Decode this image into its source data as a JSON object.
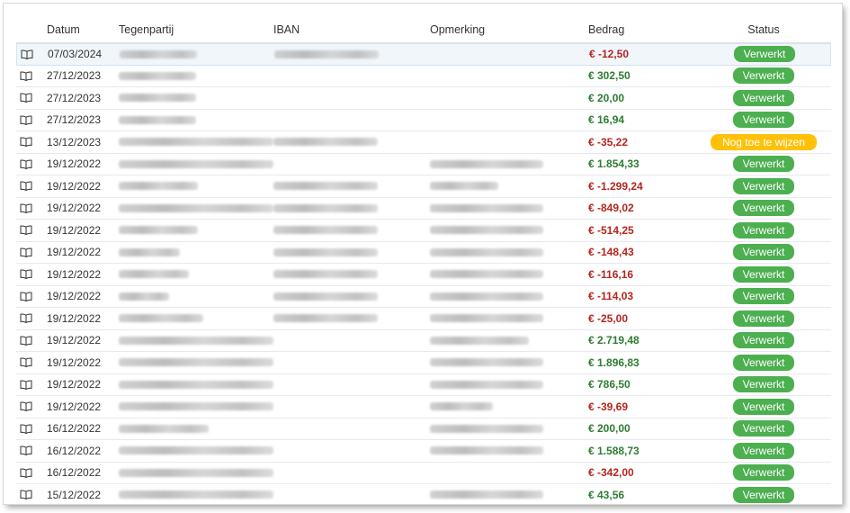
{
  "columns": {
    "date": "Datum",
    "party": "Tegenpartij",
    "iban": "IBAN",
    "note": "Opmerking",
    "amount": "Bedrag",
    "status": "Status"
  },
  "colors": {
    "positive": "#2e7d32",
    "negative": "#b3261e",
    "processed": "#4caf50",
    "pending": "#ffc107"
  },
  "icon": "open-book-icon",
  "rows": [
    {
      "date": "07/03/2024",
      "amount": "€ -12,50",
      "sign": "neg",
      "status": "Verwerkt",
      "pending": false,
      "party": true,
      "iban": true,
      "note": false
    },
    {
      "date": "27/12/2023",
      "amount": "€ 302,50",
      "sign": "pos",
      "status": "Verwerkt",
      "pending": false,
      "party": true,
      "iban": false,
      "note": false
    },
    {
      "date": "27/12/2023",
      "amount": "€ 20,00",
      "sign": "pos",
      "status": "Verwerkt",
      "pending": false,
      "party": true,
      "iban": false,
      "note": false
    },
    {
      "date": "27/12/2023",
      "amount": "€ 16,94",
      "sign": "pos",
      "status": "Verwerkt",
      "pending": false,
      "party": true,
      "iban": false,
      "note": false
    },
    {
      "date": "13/12/2023",
      "amount": "€ -35,22",
      "sign": "neg",
      "status": "Nog toe te wijzen",
      "pending": true,
      "party": true,
      "iban": true,
      "note": false
    },
    {
      "date": "19/12/2022",
      "amount": "€ 1.854,33",
      "sign": "pos",
      "status": "Verwerkt",
      "pending": false,
      "party": true,
      "iban": false,
      "note": true
    },
    {
      "date": "19/12/2022",
      "amount": "€ -1.299,24",
      "sign": "neg",
      "status": "Verwerkt",
      "pending": false,
      "party": true,
      "iban": true,
      "note": true
    },
    {
      "date": "19/12/2022",
      "amount": "€ -849,02",
      "sign": "neg",
      "status": "Verwerkt",
      "pending": false,
      "party": true,
      "iban": true,
      "note": true
    },
    {
      "date": "19/12/2022",
      "amount": "€ -514,25",
      "sign": "neg",
      "status": "Verwerkt",
      "pending": false,
      "party": true,
      "iban": true,
      "note": true
    },
    {
      "date": "19/12/2022",
      "amount": "€ -148,43",
      "sign": "neg",
      "status": "Verwerkt",
      "pending": false,
      "party": true,
      "iban": true,
      "note": true
    },
    {
      "date": "19/12/2022",
      "amount": "€ -116,16",
      "sign": "neg",
      "status": "Verwerkt",
      "pending": false,
      "party": true,
      "iban": true,
      "note": true
    },
    {
      "date": "19/12/2022",
      "amount": "€ -114,03",
      "sign": "neg",
      "status": "Verwerkt",
      "pending": false,
      "party": true,
      "iban": true,
      "note": true
    },
    {
      "date": "19/12/2022",
      "amount": "€ -25,00",
      "sign": "neg",
      "status": "Verwerkt",
      "pending": false,
      "party": true,
      "iban": true,
      "note": true
    },
    {
      "date": "19/12/2022",
      "amount": "€ 2.719,48",
      "sign": "pos",
      "status": "Verwerkt",
      "pending": false,
      "party": true,
      "iban": false,
      "note": true
    },
    {
      "date": "19/12/2022",
      "amount": "€ 1.896,83",
      "sign": "pos",
      "status": "Verwerkt",
      "pending": false,
      "party": true,
      "iban": false,
      "note": true
    },
    {
      "date": "19/12/2022",
      "amount": "€ 786,50",
      "sign": "pos",
      "status": "Verwerkt",
      "pending": false,
      "party": true,
      "iban": false,
      "note": true
    },
    {
      "date": "19/12/2022",
      "amount": "€ -39,69",
      "sign": "neg",
      "status": "Verwerkt",
      "pending": false,
      "party": true,
      "iban": false,
      "note": true
    },
    {
      "date": "16/12/2022",
      "amount": "€ 200,00",
      "sign": "pos",
      "status": "Verwerkt",
      "pending": false,
      "party": true,
      "iban": false,
      "note": true
    },
    {
      "date": "16/12/2022",
      "amount": "€ 1.588,73",
      "sign": "pos",
      "status": "Verwerkt",
      "pending": false,
      "party": true,
      "iban": false,
      "note": true
    },
    {
      "date": "16/12/2022",
      "amount": "€ -342,00",
      "sign": "neg",
      "status": "Verwerkt",
      "pending": false,
      "party": true,
      "iban": false,
      "note": false
    },
    {
      "date": "15/12/2022",
      "amount": "€ 43,56",
      "sign": "pos",
      "status": "Verwerkt",
      "pending": false,
      "party": true,
      "iban": false,
      "note": true
    }
  ]
}
